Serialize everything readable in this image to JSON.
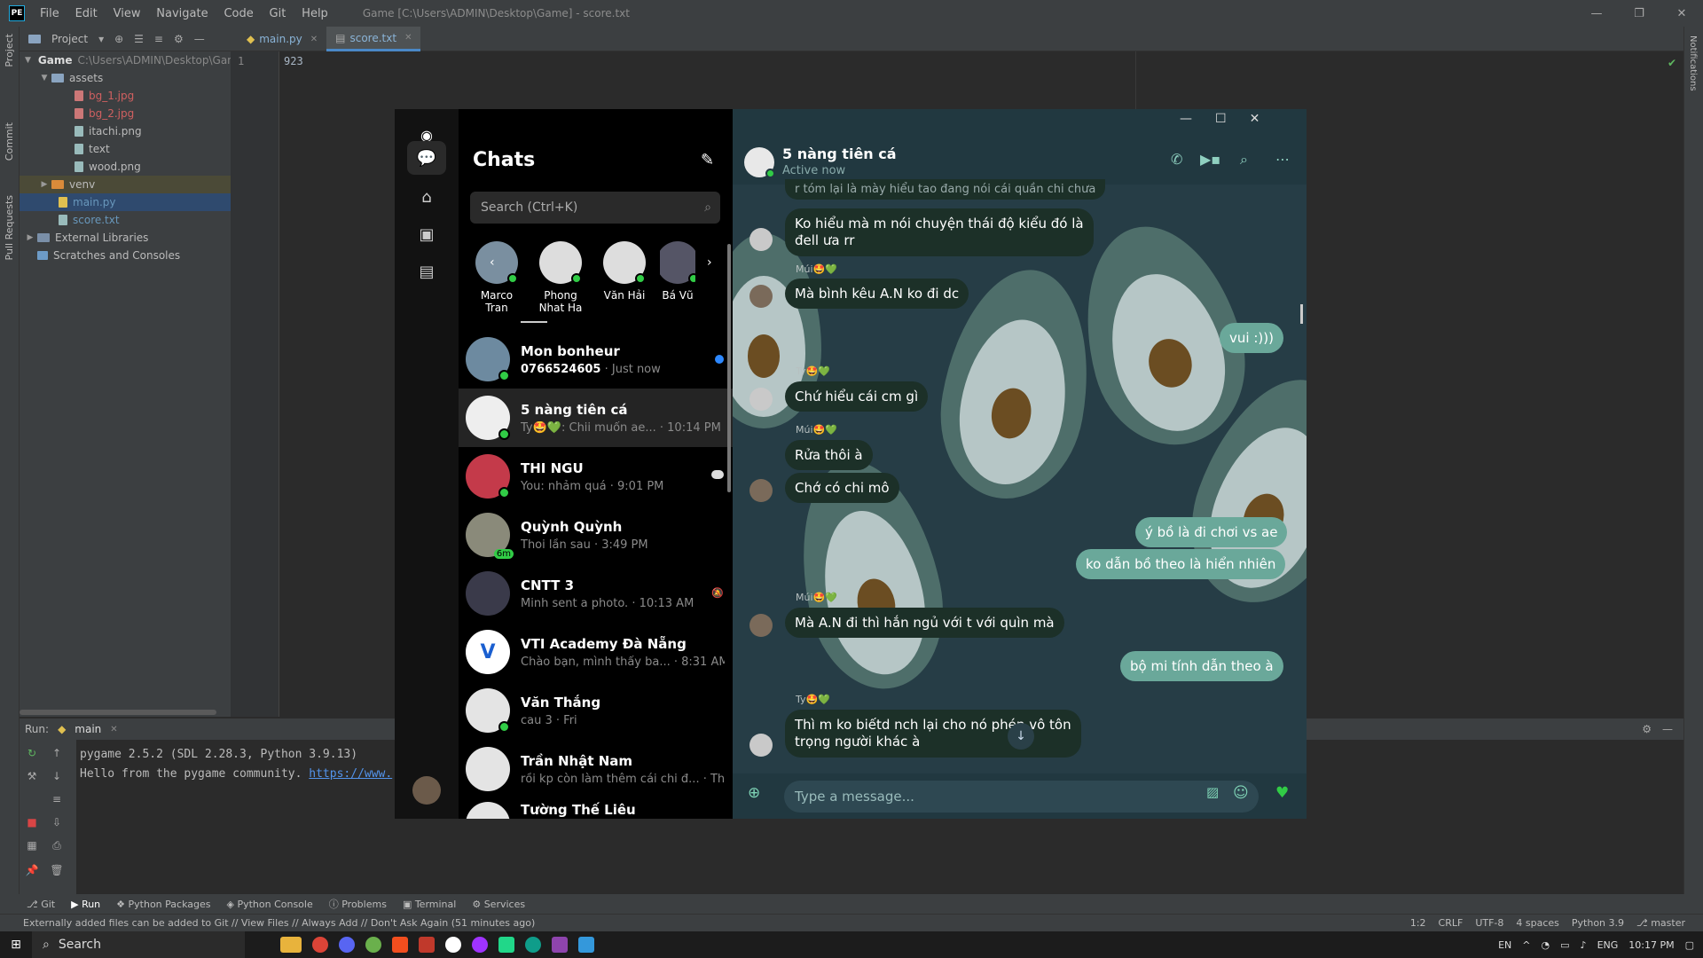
{
  "ide": {
    "logo": "PE",
    "menu": [
      "File",
      "Edit",
      "View",
      "Navigate",
      "Code",
      "Git",
      "Help"
    ],
    "window_title": "Game [C:\\Users\\ADMIN\\Desktop\\Game] - score.txt",
    "project_label": "Project",
    "tabs": [
      {
        "label": "main.py",
        "active": false
      },
      {
        "label": "score.txt",
        "active": true
      }
    ],
    "tree": [
      {
        "label": "Game",
        "dim": "C:\\Users\\ADMIN\\Desktop\\Gam",
        "type": "folder",
        "depth": 0,
        "expanded": true
      },
      {
        "label": "assets",
        "type": "folder",
        "depth": 1,
        "expanded": true
      },
      {
        "label": "bg_1.jpg",
        "type": "file",
        "depth": 2,
        "color": "red"
      },
      {
        "label": "bg_2.jpg",
        "type": "file",
        "depth": 2,
        "color": "red"
      },
      {
        "label": "itachi.png",
        "type": "file",
        "depth": 2
      },
      {
        "label": "text",
        "type": "file",
        "depth": 2
      },
      {
        "label": "wood.png",
        "type": "file",
        "depth": 2
      },
      {
        "label": "venv",
        "type": "folder",
        "depth": 1,
        "expanded": false,
        "orange": true
      },
      {
        "label": "main.py",
        "type": "file",
        "depth": 1,
        "color": "blue",
        "selected": true
      },
      {
        "label": "score.txt",
        "type": "file",
        "depth": 1,
        "color": "blue"
      },
      {
        "label": "External Libraries",
        "type": "folder",
        "depth": 0,
        "expanded": false
      },
      {
        "label": "Scratches and Consoles",
        "type": "folder",
        "depth": 0
      }
    ],
    "line_number": "1",
    "code": "923",
    "left_strip": [
      "Project",
      "Commit",
      "Pull Requests"
    ],
    "right_strip": "Notifications",
    "run": {
      "label": "Run:",
      "tab": "main",
      "line1": "pygame 2.5.2 (SDL 2.28.3, Python 3.9.13)",
      "line2_prefix": "Hello from the pygame community. ",
      "line2_link": "https://www."
    },
    "tool_tabs": [
      "Git",
      "Run",
      "Python Packages",
      "Python Console",
      "Problems",
      "Terminal",
      "Services"
    ],
    "status_message": "Externally added files can be added to Git // View Files // Always Add // Don't Ask Again (51 minutes ago)",
    "status_right": [
      "1:2",
      "CRLF",
      "UTF-8",
      "4 spaces",
      "Python 3.9",
      "master"
    ]
  },
  "taskbar": {
    "search_label": "Search",
    "lang": "EN",
    "ime": "ENG",
    "time": "10:17 PM"
  },
  "messenger": {
    "title": "Chats",
    "search_placeholder": "Search (Ctrl+K)",
    "stories": [
      {
        "name": "Marco Tran"
      },
      {
        "name": "Phong Nhat Ha"
      },
      {
        "name": "Văn Hải"
      },
      {
        "name": "Bá Vũ"
      }
    ],
    "chats": [
      {
        "name": "Mon bonheur",
        "preview": "0766524605",
        "time": " · Just now",
        "bold": true,
        "unread": true
      },
      {
        "name": "5 nàng tiên cá",
        "preview": "Ty🤩💚: Chii muốn ae...",
        "time": " · 10:14 PM",
        "selected": true
      },
      {
        "name": "THI NGU",
        "preview": "You: nhảm quá",
        "time": " · 9:01 PM"
      },
      {
        "name": "Quỳnh Quỳnh",
        "preview": "Thoi lần sau",
        "time": " · 3:49 PM",
        "badge": "6m"
      },
      {
        "name": "CNTT 3",
        "preview": "Minh sent a photo.",
        "time": " · 10:13 AM"
      },
      {
        "name": "VTI Academy Đà Nẵng",
        "preview": "Chào bạn, mình thấy ba...",
        "time": " · 8:31 AM"
      },
      {
        "name": "Văn Thắng",
        "preview": "cau 3",
        "time": " · Fri"
      },
      {
        "name": "Trần Nhật Nam",
        "preview": "rồi kp còn làm thêm cái chi đ...",
        "time": " · Thu"
      },
      {
        "name": "Tường Thế Liêu",
        "preview": "",
        "time": ""
      }
    ],
    "conversation": {
      "name": "5 nàng tiên cá",
      "status": "Active now",
      "input_placeholder": "Type a message...",
      "messages": [
        {
          "dir": "in",
          "text": "r tóm lại là mày hiểu tao đang nói cái quần chi chưa"
        },
        {
          "dir": "in",
          "text": "Ko hiểu mà m nói chuyện thái độ kiểu đó là\nđell ưa rr"
        },
        {
          "dir": "in",
          "sender": "Múi🤩💚",
          "text": "Mà bình kêu A.N ko đi dc"
        },
        {
          "dir": "out",
          "text": "vui :)))"
        },
        {
          "dir": "in",
          "sender": "Ty🤩💚",
          "text": "Chứ hiểu cái cm gì"
        },
        {
          "dir": "in",
          "sender": "Múi🤩💚",
          "text": "Rửa thôi à"
        },
        {
          "dir": "in",
          "text": "Chớ có chi mô"
        },
        {
          "dir": "out",
          "text": "ý bồ là đi chơi vs ae"
        },
        {
          "dir": "out",
          "text": "ko dẫn bồ theo là hiển nhiên"
        },
        {
          "dir": "in",
          "sender": "Múi🤩💚",
          "text": "Mà A.N đi thì hắn ngủ với t với quìn mà"
        },
        {
          "dir": "out",
          "text": "bộ mi tính dẫn theo à"
        },
        {
          "dir": "in",
          "sender": "Ty🤩💚",
          "text": "Thì m ko biếtd nch lại cho nó phép vô tôn\ntrọng người khác à"
        }
      ]
    },
    "colors": {
      "online": "#31cc46",
      "bubble_out": "#6aa89a",
      "bubble_in": "#1c3028",
      "accent": "#7fd4b6"
    }
  }
}
